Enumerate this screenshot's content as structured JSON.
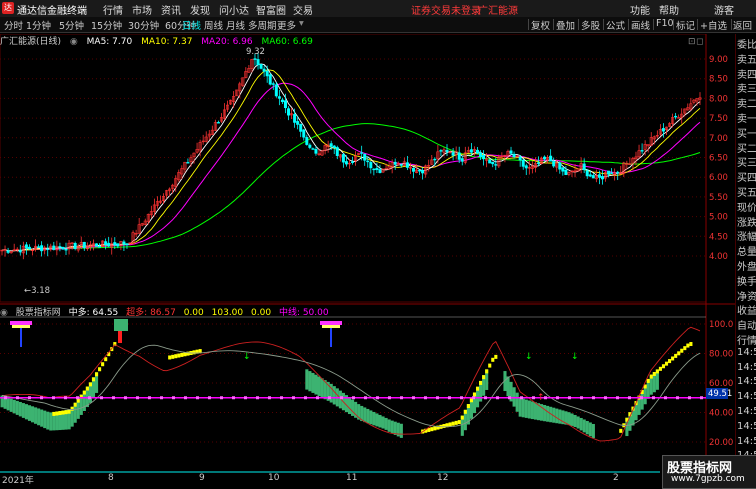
{
  "titlebar": {
    "app_name": "通达信金融终端",
    "menus": [
      "行情",
      "市场",
      "资讯",
      "发现",
      "问小达",
      "智富圈",
      "交易"
    ],
    "login_notice": "证券交易未登录",
    "stock_tag": "广汇能源",
    "right_menus": [
      "功能",
      "帮助",
      "游客"
    ]
  },
  "toolbar": {
    "periods": [
      "分时",
      "1分钟",
      "5分钟",
      "15分钟",
      "30分钟",
      "60分钟",
      "日线",
      "周线",
      "月线",
      "多周期",
      "更多"
    ],
    "active_period": "日线",
    "right_buttons": [
      "复权",
      "叠加",
      "多股",
      "公式",
      "画线",
      "F10",
      "标记",
      "+自选",
      "返回"
    ]
  },
  "main_chart": {
    "stock_title": "广汇能源(日线)",
    "ma": [
      {
        "label": "MA5: 7.70",
        "color": "#ffffff"
      },
      {
        "label": "MA10: 7.37",
        "color": "#ffff00"
      },
      {
        "label": "MA20: 6.96",
        "color": "#ff00ff"
      },
      {
        "label": "MA60: 6.69",
        "color": "#00ff00"
      }
    ],
    "high_label": "9.32",
    "low_label": "3.18",
    "price_axis": [
      "9.00",
      "8.50",
      "8.00",
      "7.50",
      "7.00",
      "6.50",
      "6.00",
      "5.50",
      "5.00",
      "4.50",
      "4.00"
    ]
  },
  "indicator": {
    "name": "股票指标网",
    "values": [
      {
        "label": "中多: 64.55",
        "color": "#ffffff"
      },
      {
        "label": "超多: 86.57",
        "color": "#ff3333"
      },
      {
        "label": "0.00",
        "color": "#ffff00"
      },
      {
        "label": "103.00",
        "color": "#ffff00"
      },
      {
        "label": "0.00",
        "color": "#ffff00"
      },
      {
        "label": "中线: 50.00",
        "color": "#ff00ff"
      }
    ],
    "axis": [
      "100.0",
      "80.00",
      "60.00",
      "40.00",
      "20.00"
    ],
    "current_value": "49.51"
  },
  "right_panel": {
    "items": [
      "委比",
      "卖五",
      "卖四",
      "卖三",
      "卖二",
      "卖一",
      "买一",
      "买二",
      "买三",
      "买四",
      "买五",
      "现价",
      "涨跌",
      "涨幅",
      "总量",
      "外盘",
      "换手",
      "净资",
      "收益",
      "自动",
      "行情",
      "14:5",
      "14:5",
      "14:5",
      "14:5",
      "14:5",
      "14:5",
      "14:5",
      "14:5",
      "14:5"
    ]
  },
  "date_axis": [
    "2021年",
    "8",
    "9",
    "10",
    "11",
    "12",
    "2"
  ],
  "watermark": {
    "title": "股票指标网",
    "url": "www.7gpzb.com"
  },
  "colors": {
    "up": "#ff3333",
    "down": "#00ffff",
    "grid": "#550000",
    "ma5": "#ffffff",
    "ma10": "#ffff00",
    "ma20": "#ff00ff",
    "ma60": "#00ff00",
    "band": "#3cb371"
  }
}
